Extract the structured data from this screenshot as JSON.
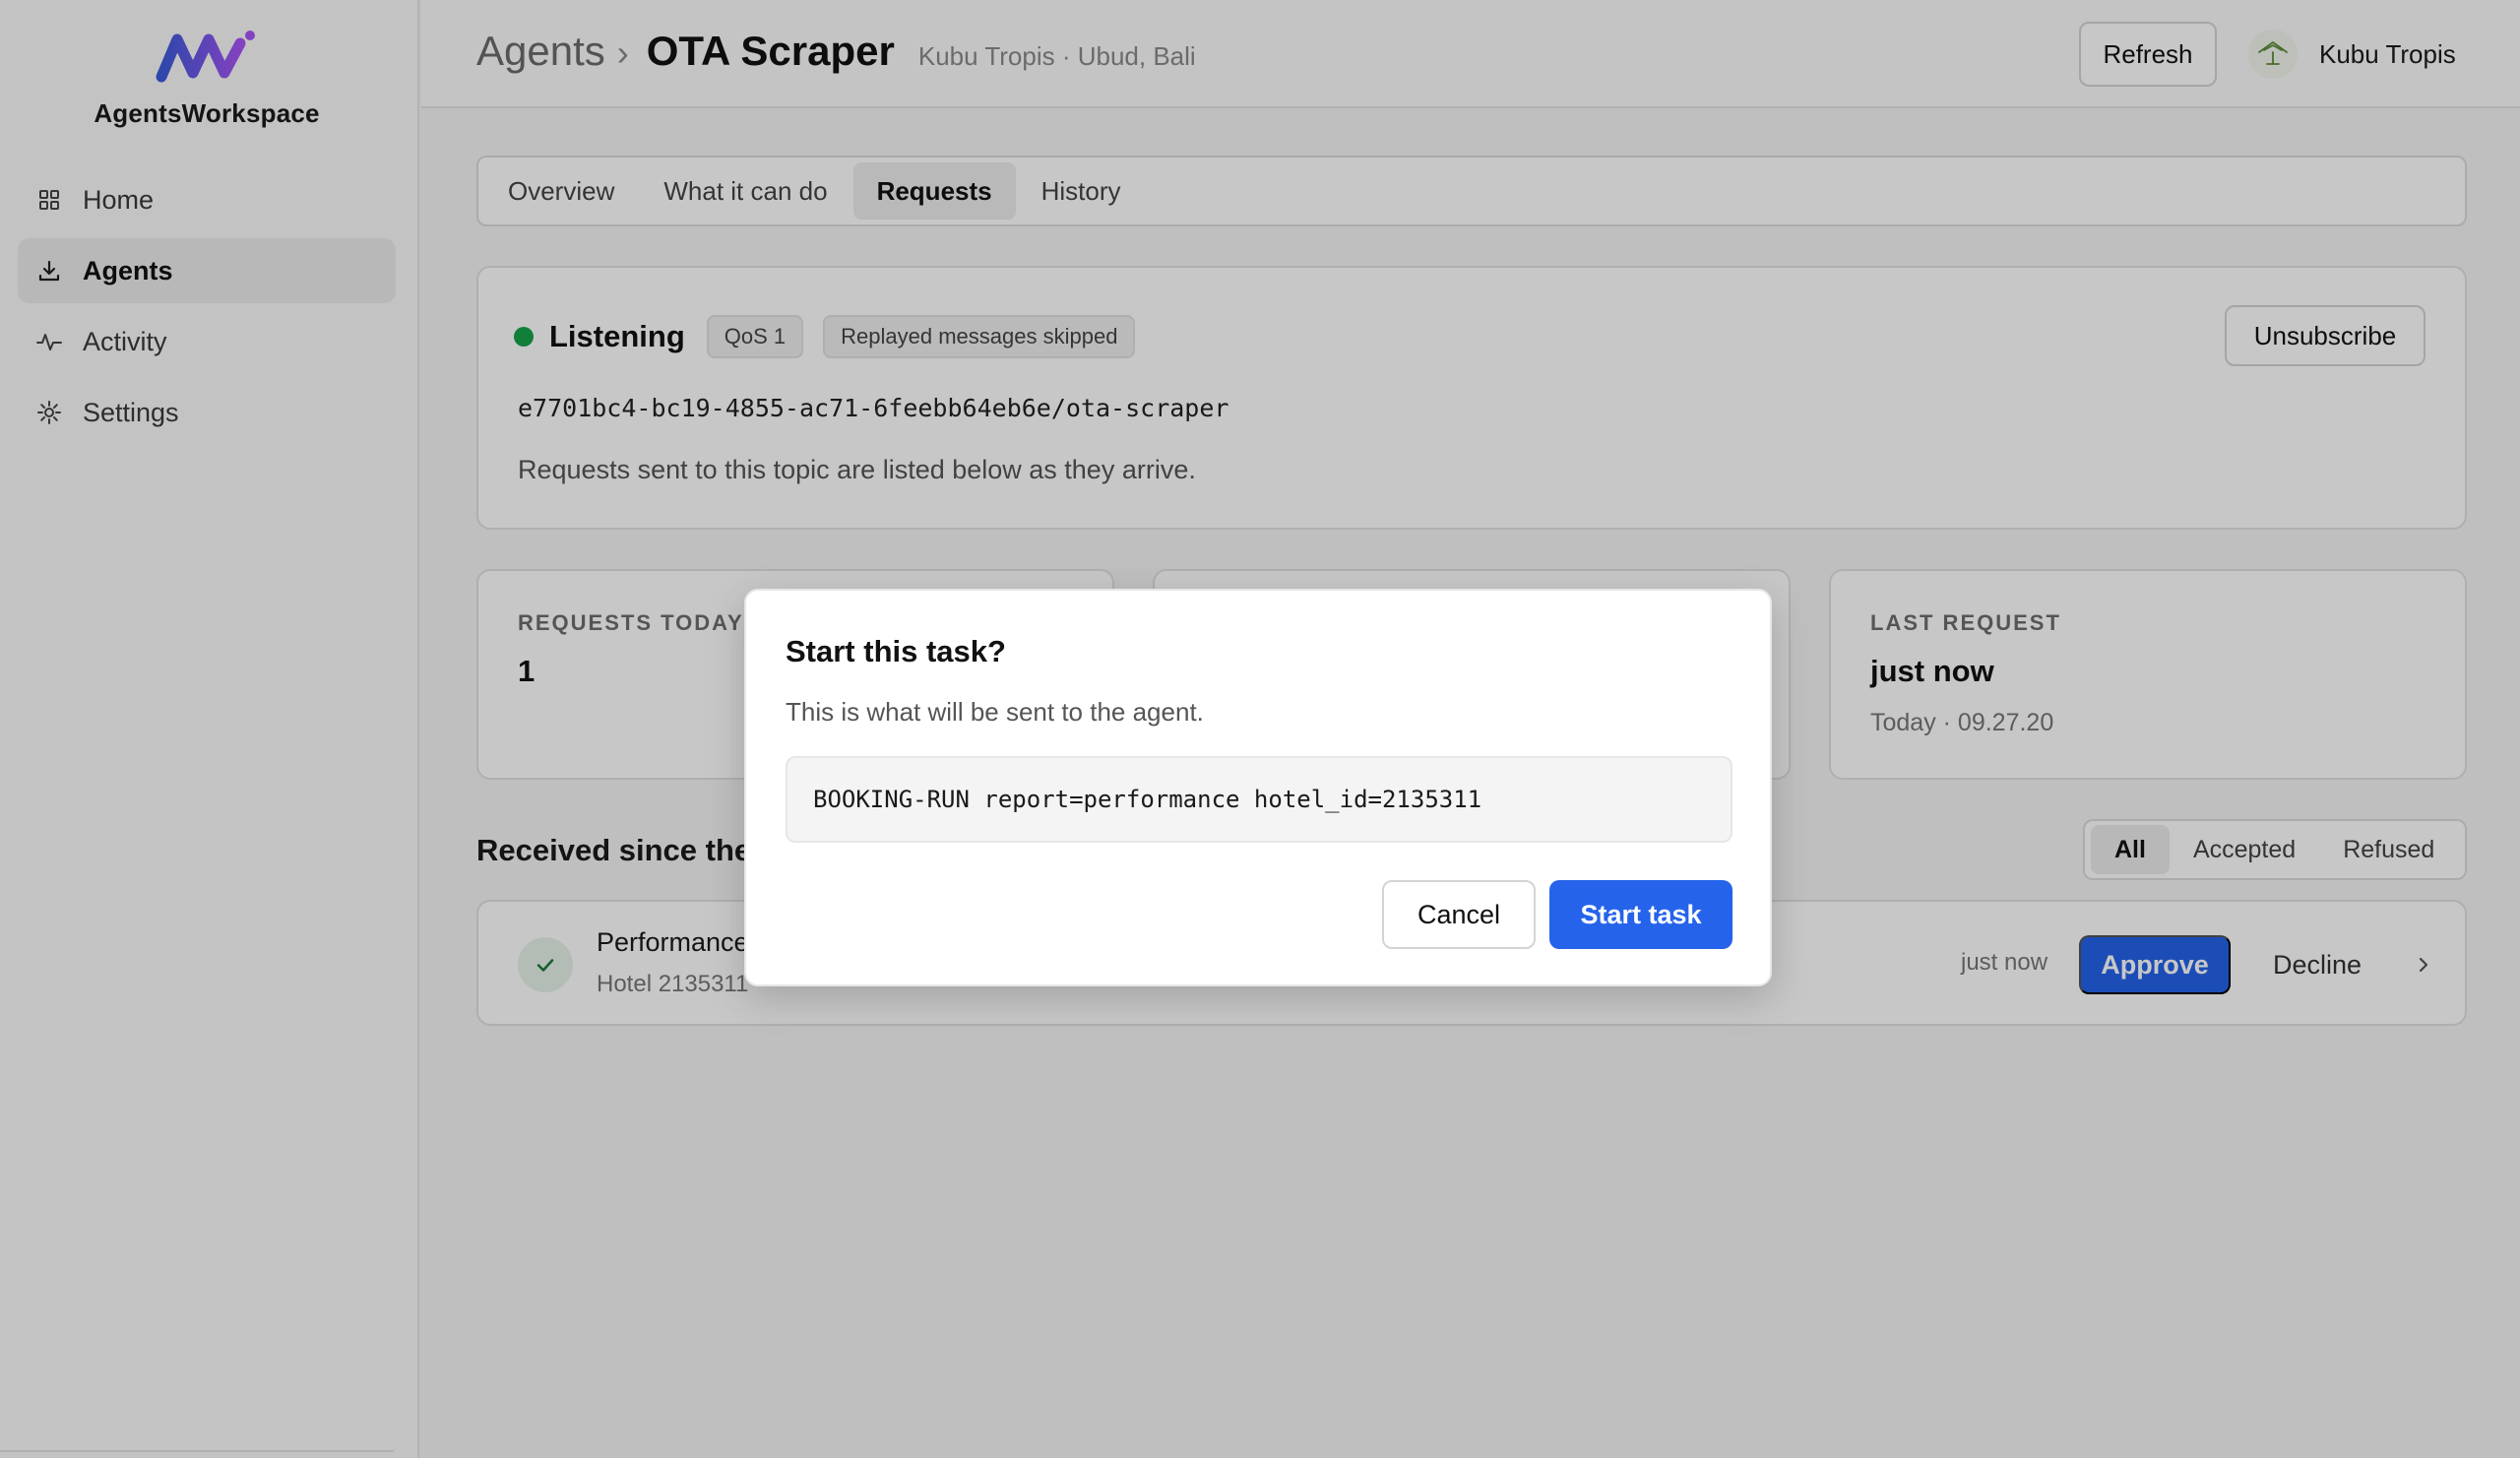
{
  "app": {
    "brand": "AgentsWorkspace"
  },
  "sidebar": {
    "items": [
      {
        "label": "Home",
        "icon": "grid-icon",
        "active": false
      },
      {
        "label": "Agents",
        "icon": "download-tray-icon",
        "active": true
      },
      {
        "label": "Activity",
        "icon": "pulse-icon",
        "active": false
      },
      {
        "label": "Settings",
        "icon": "gear-icon",
        "active": false
      }
    ]
  },
  "header": {
    "breadcrumb_root": "Agents",
    "breadcrumb_sep": "›",
    "title": "OTA Scraper",
    "subtitle": "Kubu Tropis · Ubud, Bali",
    "refresh_label": "Refresh",
    "user_name": "Kubu Tropis"
  },
  "tabs": [
    {
      "label": "Overview",
      "active": false
    },
    {
      "label": "What it can do",
      "active": false
    },
    {
      "label": "Requests",
      "active": true
    },
    {
      "label": "History",
      "active": false
    }
  ],
  "status": {
    "label": "Listening",
    "badge_qos": "QoS 1",
    "badge_replay": "Replayed messages skipped",
    "topic": "e7701bc4-bc19-4855-ac71-6feebb64eb6e/ota-scraper",
    "description": "Requests sent to this topic are listed below as they arrive.",
    "unsubscribe_label": "Unsubscribe",
    "dot_color": "#16a34a"
  },
  "stats": {
    "requests_today_label": "REQUESTS TODAY",
    "requests_today_value": "1",
    "last_request_label": "LAST REQUEST",
    "last_request_value": "just now",
    "last_request_meta": "Today · 09.27.20"
  },
  "received": {
    "title": "Received since the",
    "filters": [
      {
        "label": "All",
        "active": true
      },
      {
        "label": "Accepted",
        "active": false
      },
      {
        "label": "Refused",
        "active": false
      }
    ],
    "rows": [
      {
        "title": "Performance",
        "subtitle": "Hotel 2135311",
        "time": "just now",
        "approve_label": "Approve",
        "decline_label": "Decline"
      }
    ]
  },
  "modal": {
    "title": "Start this task?",
    "description": "This is what will be sent to the agent.",
    "command": "BOOKING-RUN report=performance hotel_id=2135311",
    "cancel_label": "Cancel",
    "confirm_label": "Start task"
  },
  "colors": {
    "accent": "#2563eb",
    "success": "#16a34a",
    "brand_gradient_start": "#3b5bdb",
    "brand_gradient_end": "#a855f7"
  }
}
